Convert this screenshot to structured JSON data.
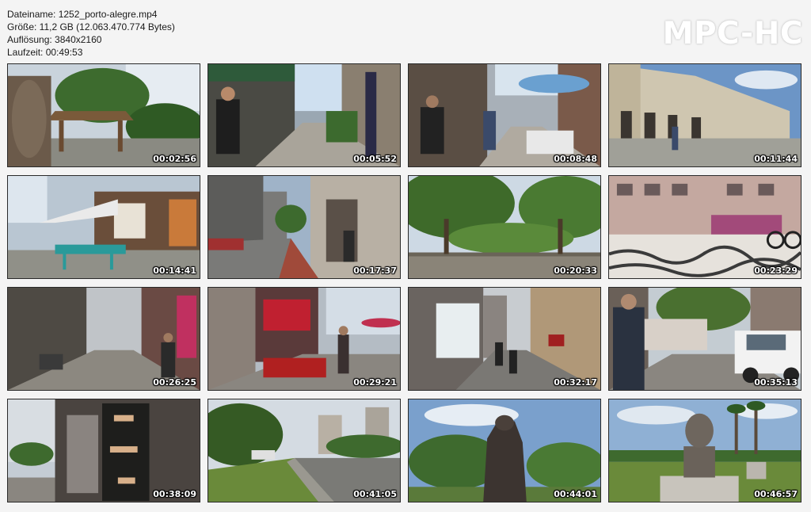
{
  "file_info": {
    "name": "Dateiname: 1252_porto-alegre.mp4",
    "size": "Größe: 11,2 GB (12.063.470.774 Bytes)",
    "resolution": "Auflösung: 3840x2160",
    "duration": "Laufzeit: 00:49:53"
  },
  "logo": "MPC-HC",
  "thumbnails": [
    {
      "time": "00:02:56",
      "scene": "park-gazebo"
    },
    {
      "time": "00:05:52",
      "scene": "street-man"
    },
    {
      "time": "00:08:48",
      "scene": "street-umbrella"
    },
    {
      "time": "00:11:44",
      "scene": "historic-building"
    },
    {
      "time": "00:14:41",
      "scene": "street-cafe"
    },
    {
      "time": "00:17:37",
      "scene": "avenue"
    },
    {
      "time": "00:20:33",
      "scene": "plaza-trees"
    },
    {
      "time": "00:23:29",
      "scene": "mosaic-plaza"
    },
    {
      "time": "00:26:25",
      "scene": "pedestrian-street"
    },
    {
      "time": "00:29:21",
      "scene": "market-stall"
    },
    {
      "time": "00:32:17",
      "scene": "shop-street"
    },
    {
      "time": "00:35:13",
      "scene": "man-car"
    },
    {
      "time": "00:38:09",
      "scene": "shop-sign"
    },
    {
      "time": "00:41:05",
      "scene": "highway"
    },
    {
      "time": "00:44:01",
      "scene": "statue-park"
    },
    {
      "time": "00:46:57",
      "scene": "bust-palms"
    }
  ]
}
